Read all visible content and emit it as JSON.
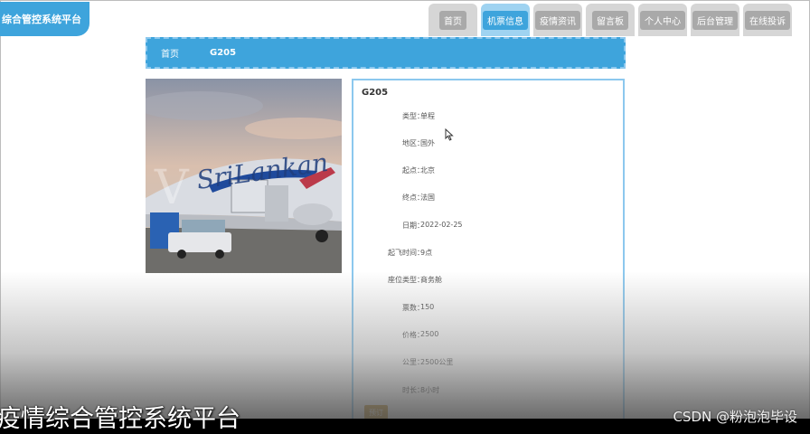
{
  "header": {
    "site_title": "综合管控系统平台"
  },
  "nav": {
    "items": [
      {
        "label": "首页",
        "active": false
      },
      {
        "label": "机票信息",
        "active": true
      },
      {
        "label": "疫情资讯",
        "active": false
      },
      {
        "label": "留言板",
        "active": false
      },
      {
        "label": "个人中心",
        "active": false
      },
      {
        "label": "后台管理",
        "active": false
      },
      {
        "label": "在线投诉",
        "active": false
      }
    ]
  },
  "breadcrumb": {
    "home": "首页",
    "current": "G205"
  },
  "detail": {
    "title": "G205",
    "fields": [
      {
        "label": "类型：",
        "value": "单程"
      },
      {
        "label": "地区：",
        "value": "国外"
      },
      {
        "label": "起点：",
        "value": "北京"
      },
      {
        "label": "终点：",
        "value": "法国"
      },
      {
        "label": "日期：",
        "value": "2022-02-25"
      },
      {
        "label": "起飞时间：",
        "value": "9点"
      },
      {
        "label": "座位类型：",
        "value": "商务舱"
      },
      {
        "label": "票数：",
        "value": "150"
      },
      {
        "label": "价格：",
        "value": "2500"
      },
      {
        "label": "公里：",
        "value": "2500公里"
      },
      {
        "label": "时长：",
        "value": "8小时"
      }
    ],
    "submit_label": "预订"
  },
  "photo": {
    "airline_text": "SriLankan"
  },
  "caption": {
    "text": "疫情综合管控系统平台"
  },
  "watermark": {
    "text": "CSDN @粉泡泡毕设"
  },
  "colors": {
    "accent": "#3ea4dc",
    "accent_light": "#8cc8ee",
    "tab_inactive": "#a9a9a9",
    "button": "#c79a3f"
  }
}
